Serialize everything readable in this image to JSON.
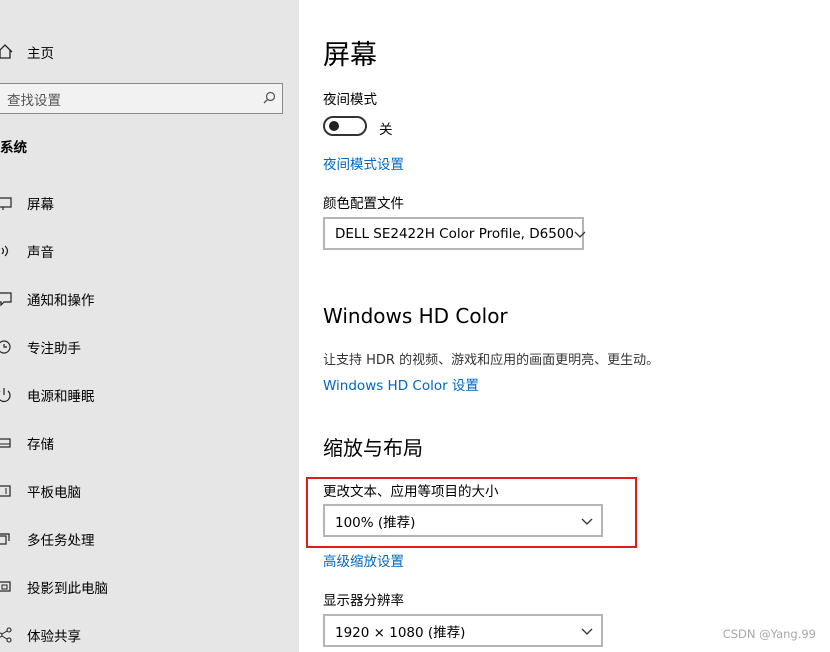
{
  "sidebar": {
    "home_label": "主页",
    "search_placeholder": "查找设置",
    "section_title": "系统",
    "items": [
      {
        "label": "屏幕",
        "icon": "monitor-icon"
      },
      {
        "label": "声音",
        "icon": "speaker-icon"
      },
      {
        "label": "通知和操作",
        "icon": "notification-icon"
      },
      {
        "label": "专注助手",
        "icon": "moon-icon"
      },
      {
        "label": "电源和睡眠",
        "icon": "power-icon"
      },
      {
        "label": "存储",
        "icon": "storage-icon"
      },
      {
        "label": "平板电脑",
        "icon": "tablet-icon"
      },
      {
        "label": "多任务处理",
        "icon": "multitask-icon"
      },
      {
        "label": "投影到此电脑",
        "icon": "project-icon"
      },
      {
        "label": "体验共享",
        "icon": "share-icon"
      }
    ]
  },
  "main": {
    "title": "屏幕",
    "night_light": {
      "label": "夜间模式",
      "state_text": "关",
      "state": "off",
      "settings_link": "夜间模式设置"
    },
    "color_profile": {
      "label": "颜色配置文件",
      "value": "DELL SE2422H Color Profile, D6500"
    },
    "hd_color": {
      "heading": "Windows HD Color",
      "description": "让支持 HDR 的视频、游戏和应用的画面更明亮、更生动。",
      "link": "Windows HD Color 设置"
    },
    "scale_layout": {
      "heading": "缩放与布局",
      "scale_label": "更改文本、应用等项目的大小",
      "scale_value": "100% (推荐)",
      "advanced_link": "高级缩放设置",
      "resolution_label": "显示器分辨率",
      "resolution_value": "1920 × 1080 (推荐)"
    }
  },
  "watermark": "CSDN @Yang.99",
  "colors": {
    "sidebar_bg": "#e6e6e6",
    "link": "#0067c0",
    "highlight": "#e01c1c"
  }
}
